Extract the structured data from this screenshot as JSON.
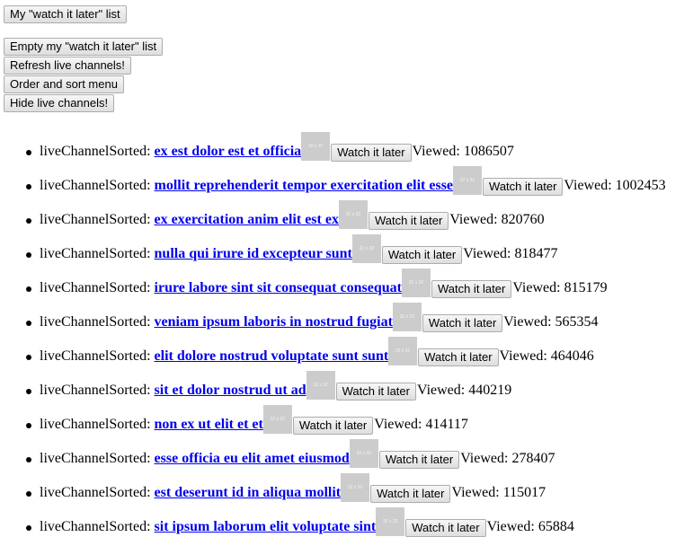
{
  "top_buttons": [
    "My \"watch it later\" list",
    "Empty my \"watch it later\" list",
    "Refresh live channels!",
    "Order and sort menu",
    "Hide live channels!"
  ],
  "channel_prefix": "liveChannelSorted:",
  "watch_label": "Watch it later",
  "viewed_label": "Viewed:",
  "thumb_text": "32 x 32",
  "channels": [
    {
      "title": "ex est dolor est et officia",
      "views": "1086507"
    },
    {
      "title": "mollit reprehenderit tempor exercitation elit esse",
      "views": "1002453"
    },
    {
      "title": "ex exercitation anim elit est ex",
      "views": "820760"
    },
    {
      "title": "nulla qui irure id excepteur sunt",
      "views": "818477"
    },
    {
      "title": "irure labore sint sit consequat consequat",
      "views": "815179"
    },
    {
      "title": "veniam ipsum laboris in nostrud fugiat",
      "views": "565354"
    },
    {
      "title": "elit dolore nostrud voluptate sunt sunt",
      "views": "464046"
    },
    {
      "title": "sit et dolor nostrud ut ad",
      "views": "440219"
    },
    {
      "title": "non ex ut elit et et",
      "views": "414117"
    },
    {
      "title": "esse officia eu elit amet eiusmod",
      "views": "278407"
    },
    {
      "title": "est deserunt id in aliqua mollit",
      "views": "115017"
    },
    {
      "title": "sit ipsum laborum elit voluptate sint",
      "views": "65884"
    }
  ]
}
